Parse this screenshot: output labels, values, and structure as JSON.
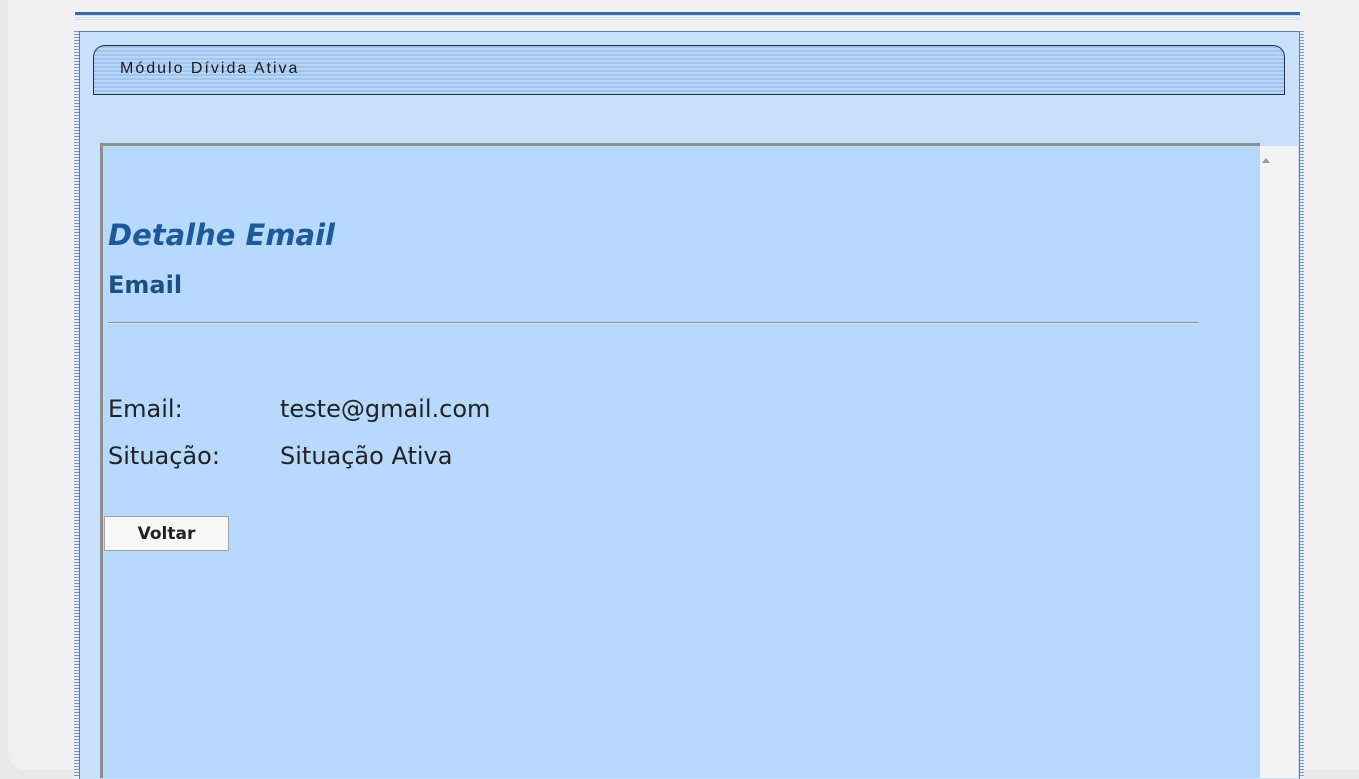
{
  "module": {
    "title": "Módulo Dívida Ativa"
  },
  "page": {
    "heading": "Detalhe Email",
    "subheading": "Email"
  },
  "fields": [
    {
      "label": "Email:",
      "value": "teste@gmail.com"
    },
    {
      "label": "Situação:",
      "value": "Situação Ativa"
    }
  ],
  "actions": {
    "back_label": "Voltar"
  },
  "colors": {
    "accent_bar": "#3e67a8",
    "frame_bg": "#c9e0fa",
    "content_bg": "#b6d9fd",
    "heading_color": "#1d5a99"
  },
  "icons": {
    "scroll_up": "scroll-up-arrow-icon"
  }
}
